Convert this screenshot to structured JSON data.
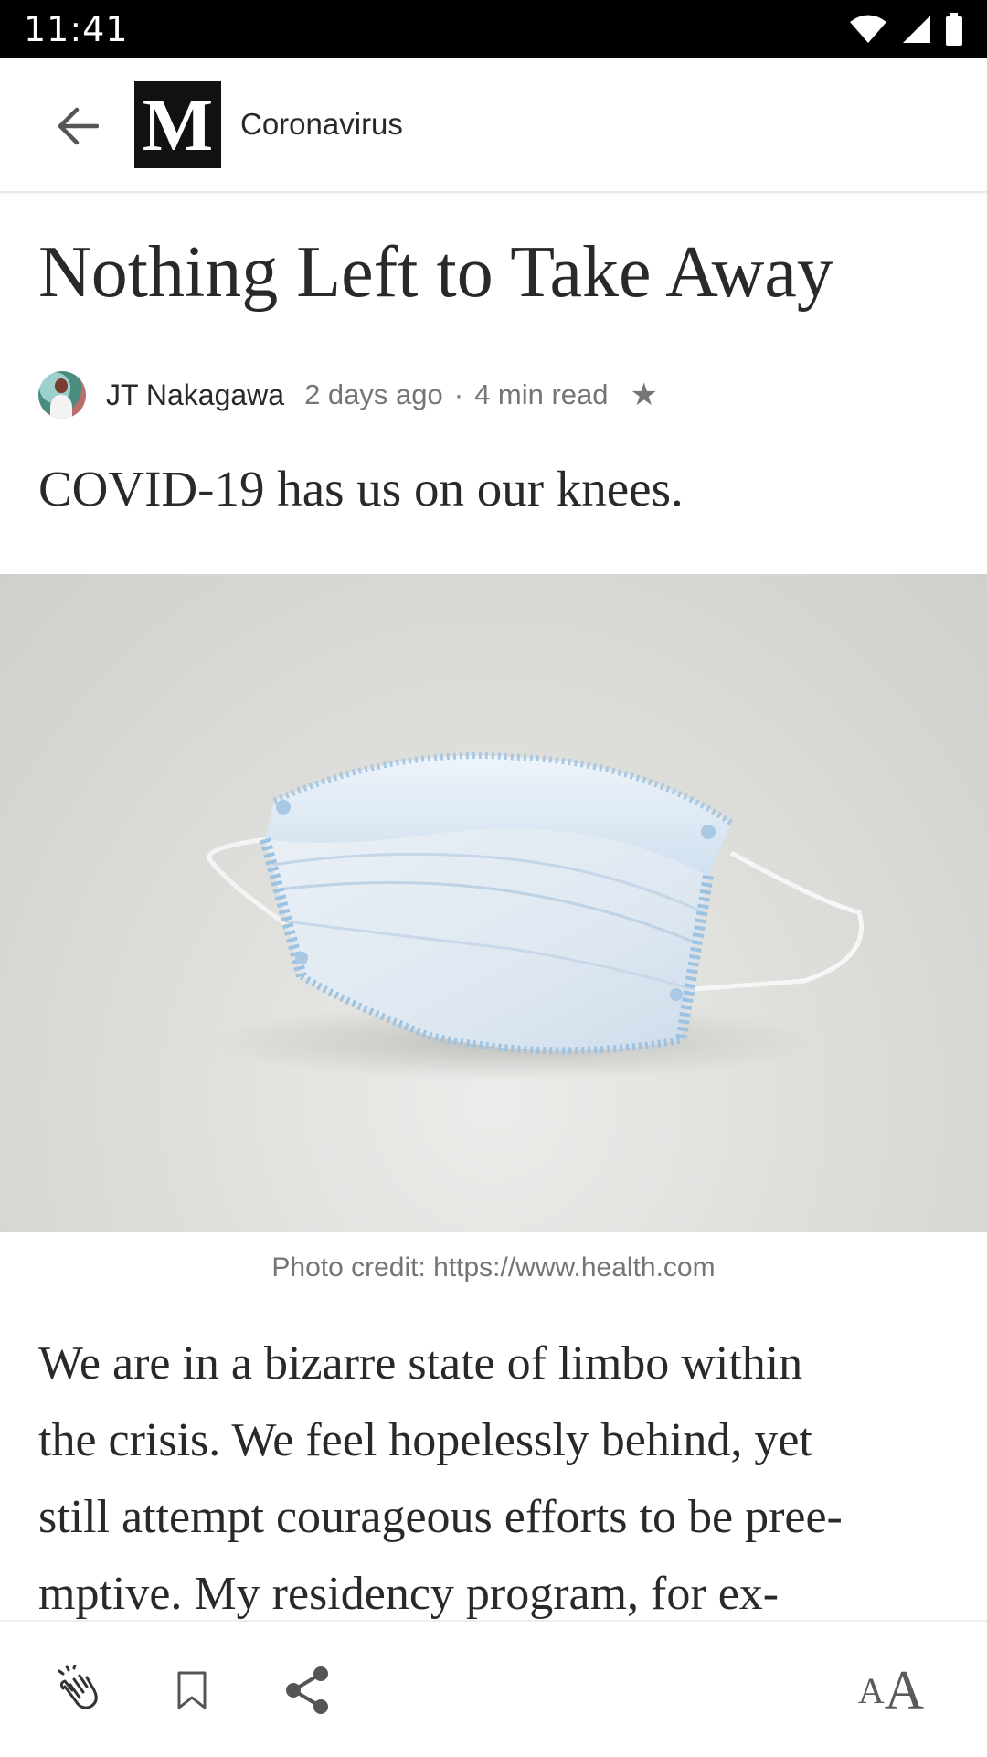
{
  "status_bar": {
    "time": "11:41",
    "icons": [
      "wifi-icon",
      "cellular-signal-icon",
      "battery-icon"
    ]
  },
  "app_bar": {
    "back_icon": "arrow-left-icon",
    "publication_logo": "M",
    "publication_name": "Coronavirus"
  },
  "article": {
    "title": "Nothing Left to Take Away",
    "author": "JT Nakagawa",
    "posted": "2 days ago",
    "separator": "·",
    "read_time": "4 min read",
    "member_icon": "star-icon",
    "subtitle": "COVID-19 has us on our knees.",
    "image_subject": "surgical-face-mask",
    "caption": "Photo credit: https://www.health.com",
    "body_lines": [
      "We are in a bizarre state of limbo within",
      "the crisis. We feel hopelessly behind, yet",
      "still attempt courageous efforts to be pree-",
      "mptive. My residency program, for ex-"
    ]
  },
  "toolbar": {
    "clap_icon": "clap-icon",
    "bookmark_icon": "bookmark-icon",
    "share_icon": "share-icon",
    "text_size_small": "A",
    "text_size_large": "A"
  },
  "colors": {
    "text": "#292929",
    "meta": "#757575",
    "status_bar": "#000000",
    "mask_blue": "#9cc3e2"
  }
}
